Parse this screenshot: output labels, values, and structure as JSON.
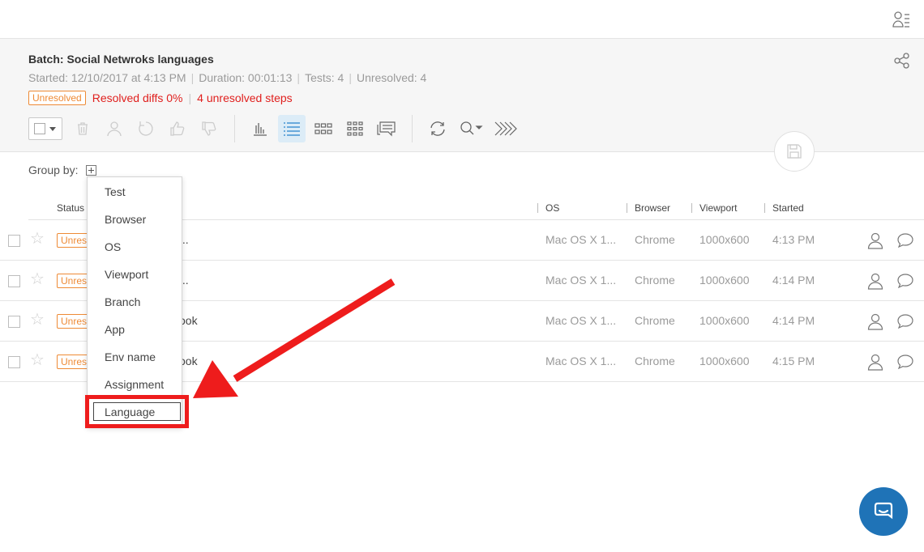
{
  "batch": {
    "title": "Batch: Social Netwroks languages",
    "started": "Started: 12/10/2017 at 4:13 PM",
    "duration": "Duration: 00:01:13",
    "tests": "Tests: 4",
    "unresolved": "Unresolved: 4",
    "separator": "|",
    "status_badge": "Unresolved",
    "resolved_diffs": "Resolved diffs 0%",
    "unresolved_steps": "4 unresolved steps"
  },
  "group_by": {
    "label": "Group by:"
  },
  "columns": [
    "Status",
    "OS",
    "Browser",
    "Viewport",
    "Started"
  ],
  "menu": {
    "items": [
      "Test",
      "Browser",
      "OS",
      "Viewport",
      "Branch",
      "App",
      "Env name",
      "Assignment",
      "Language"
    ]
  },
  "rows": [
    {
      "status": "Unresolved",
      "name": "...",
      "os": "Mac OS X 1...",
      "browser": "Chrome",
      "viewport": "1000x600",
      "started": "4:13 PM"
    },
    {
      "status": "Unresolved",
      "name": "...",
      "os": "Mac OS X 1...",
      "browser": "Chrome",
      "viewport": "1000x600",
      "started": "4:14 PM"
    },
    {
      "status": "Unresolved",
      "name": "ook",
      "os": "Mac OS X 1...",
      "browser": "Chrome",
      "viewport": "1000x600",
      "started": "4:14 PM"
    },
    {
      "status": "Unresolved",
      "name": "ook",
      "os": "Mac OS X 1...",
      "browser": "Chrome",
      "viewport": "1000x600",
      "started": "4:15 PM"
    }
  ],
  "icons": {
    "topbar": "user-list-icon",
    "share": "share-icon",
    "toolbar": [
      "select-all-dropdown",
      "delete-icon",
      "assign-user-icon",
      "undo-icon",
      "thumbs-up-icon",
      "thumbs-down-icon",
      "bar-chart-icon",
      "list-view-icon",
      "small-grid-icon",
      "large-grid-icon",
      "comments-icon",
      "refresh-icon",
      "search-icon",
      "fast-forward-icon"
    ],
    "save": "save-icon",
    "chat": "chat-icon"
  },
  "colors": {
    "accent_orange": "#ee8a35",
    "alert_red": "#e0201e",
    "annotation_red": "#ee1c1c",
    "active_bg": "#dcecf7",
    "chat_blue": "#1f73b7"
  }
}
